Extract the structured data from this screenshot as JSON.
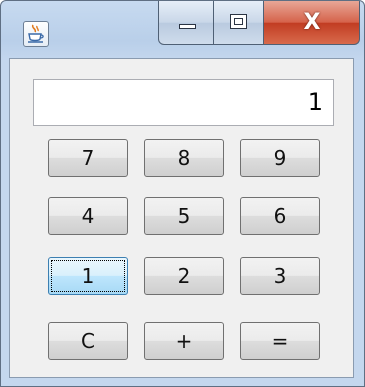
{
  "window": {
    "close_label": "X"
  },
  "display": {
    "value": "1"
  },
  "keypad": {
    "row1": [
      "7",
      "8",
      "9"
    ],
    "row2": [
      "4",
      "5",
      "6"
    ],
    "row3": [
      "1",
      "2",
      "3"
    ],
    "row4": [
      "C",
      "+",
      "="
    ]
  },
  "colors": {
    "focused_button": "#bee6fd",
    "close_button": "#c13c22",
    "titlebar": "#b9cfe9"
  },
  "icons": [
    "java-cup-icon",
    "minimize-icon",
    "maximize-icon",
    "close-icon"
  ]
}
